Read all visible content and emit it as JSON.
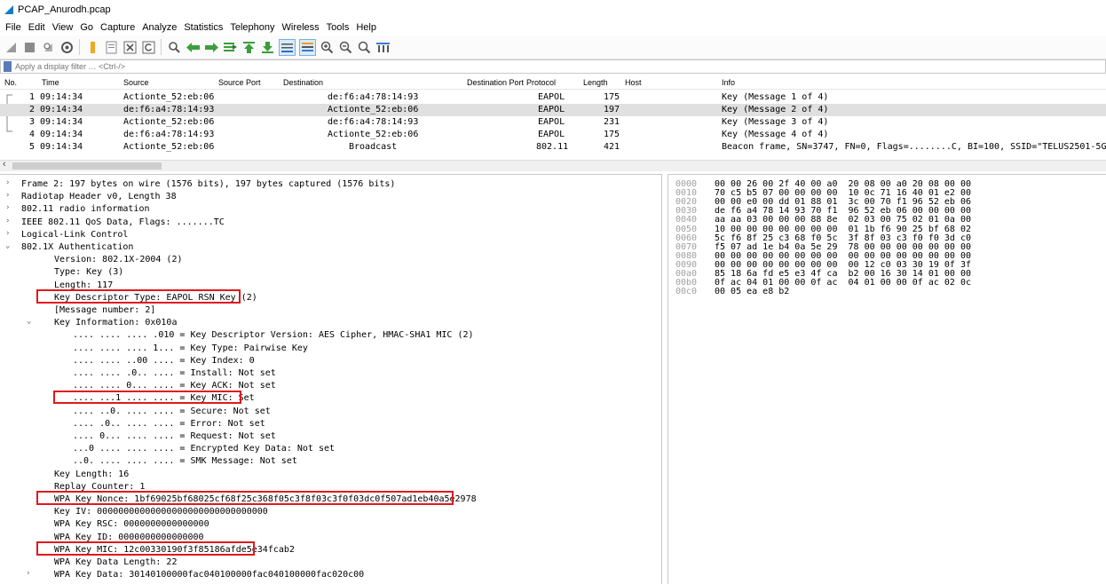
{
  "window": {
    "title": "PCAP_Anurodh.pcap"
  },
  "menu": [
    "File",
    "Edit",
    "View",
    "Go",
    "Capture",
    "Analyze",
    "Statistics",
    "Telephony",
    "Wireless",
    "Tools",
    "Help"
  ],
  "toolbar_icons": [
    "start-capture-icon",
    "stop-capture-icon",
    "restart-capture-icon",
    "capture-options-icon",
    "open-file-icon",
    "save-file-icon",
    "close-file-icon",
    "reload-file-icon",
    "find-packet-icon",
    "go-back-icon",
    "go-forward-icon",
    "go-to-packet-icon",
    "first-packet-icon",
    "last-packet-icon",
    "autoscroll-icon",
    "colorize-icon",
    "zoom-in-icon",
    "zoom-out-icon",
    "normal-size-icon",
    "resize-columns-icon"
  ],
  "filter": {
    "placeholder": "Apply a display filter … <Ctrl-/>"
  },
  "packet_list": {
    "headers": {
      "no": "No.",
      "time": "Time",
      "source": "Source",
      "source_port": "Source Port",
      "destination": "Destination",
      "destination_port": "Destination Port",
      "protocol": "Protocol",
      "length": "Length",
      "host": "Host",
      "info": "Info"
    },
    "rows": [
      {
        "no": "1",
        "time": "09:14:34",
        "source": "Actionte_52:eb:06",
        "destination": "de:f6:a4:78:14:93",
        "protocol": "EAPOL",
        "length": "175",
        "info": "Key (Message 1 of 4)"
      },
      {
        "no": "2",
        "time": "09:14:34",
        "source": "de:f6:a4:78:14:93",
        "destination": "Actionte_52:eb:06",
        "protocol": "EAPOL",
        "length": "197",
        "info": "Key (Message 2 of 4)"
      },
      {
        "no": "3",
        "time": "09:14:34",
        "source": "Actionte_52:eb:06",
        "destination": "de:f6:a4:78:14:93",
        "protocol": "EAPOL",
        "length": "231",
        "info": "Key (Message 3 of 4)"
      },
      {
        "no": "4",
        "time": "09:14:34",
        "source": "de:f6:a4:78:14:93",
        "destination": "Actionte_52:eb:06",
        "protocol": "EAPOL",
        "length": "175",
        "info": "Key (Message 4 of 4)"
      },
      {
        "no": "5",
        "time": "09:14:34",
        "source": "Actionte_52:eb:06",
        "destination": "Broadcast",
        "protocol": "802.11",
        "length": "421",
        "info": "Beacon frame, SN=3747, FN=0, Flags=........C, BI=100, SSID=\"TELUS2501-5G\""
      }
    ]
  },
  "details": [
    {
      "text": "Frame 2: 197 bytes on wire (1576 bits), 197 bytes captured (1576 bits)",
      "twisty": "›"
    },
    {
      "text": "Radiotap Header v0, Length 38",
      "twisty": "›"
    },
    {
      "text": "802.11 radio information",
      "twisty": "›"
    },
    {
      "text": "IEEE 802.11 QoS Data, Flags: .......TC",
      "twisty": "›"
    },
    {
      "text": "Logical-Link Control",
      "twisty": "›"
    },
    {
      "text": "802.1X Authentication",
      "twisty": "⌄"
    },
    {
      "text": "Version: 802.1X-2004 (2)",
      "twisty": ""
    },
    {
      "text": "Type: Key (3)",
      "twisty": ""
    },
    {
      "text": "Length: 117",
      "twisty": ""
    },
    {
      "text": "Key Descriptor Type: EAPOL RSN Key (2)",
      "twisty": ""
    },
    {
      "text": "[Message number: 2]",
      "twisty": ""
    },
    {
      "text": "Key Information: 0x010a",
      "twisty": "⌄"
    },
    {
      "text": ".... .... .... .010 = Key Descriptor Version: AES Cipher, HMAC-SHA1 MIC (2)",
      "twisty": ""
    },
    {
      "text": ".... .... .... 1... = Key Type: Pairwise Key",
      "twisty": ""
    },
    {
      "text": ".... .... ..00 .... = Key Index: 0",
      "twisty": ""
    },
    {
      "text": ".... .... .0.. .... = Install: Not set",
      "twisty": ""
    },
    {
      "text": ".... .... 0... .... = Key ACK: Not set",
      "twisty": ""
    },
    {
      "text": ".... ...1 .... .... = Key MIC: Set",
      "twisty": ""
    },
    {
      "text": ".... ..0. .... .... = Secure: Not set",
      "twisty": ""
    },
    {
      "text": ".... .0.. .... .... = Error: Not set",
      "twisty": ""
    },
    {
      "text": ".... 0... .... .... = Request: Not set",
      "twisty": ""
    },
    {
      "text": "...0 .... .... .... = Encrypted Key Data: Not set",
      "twisty": ""
    },
    {
      "text": "..0. .... .... .... = SMK Message: Not set",
      "twisty": ""
    },
    {
      "text": "Key Length: 16",
      "twisty": ""
    },
    {
      "text": "Replay Counter: 1",
      "twisty": ""
    },
    {
      "text": "WPA Key Nonce: 1bf69025bf68025cf68f25c368f05c3f8f03c3f0f03dc0f507ad1eb40a5e2978",
      "twisty": ""
    },
    {
      "text": "Key IV: 00000000000000000000000000000000",
      "twisty": ""
    },
    {
      "text": "WPA Key RSC: 0000000000000000",
      "twisty": ""
    },
    {
      "text": "WPA Key ID: 0000000000000000",
      "twisty": ""
    },
    {
      "text": "WPA Key MIC: 12c00330190f3f85186afde5e34fcab2",
      "twisty": ""
    },
    {
      "text": "WPA Key Data Length: 22",
      "twisty": ""
    },
    {
      "text": "WPA Key Data: 30140100000fac040100000fac040100000fac020c00",
      "twisty": "›"
    }
  ],
  "bytes": [
    {
      "offset": "0000",
      "hex": "00 00 26 00 2f 40 00 a0  20 08 00 a0 20 08 00 00"
    },
    {
      "offset": "0010",
      "hex": "70 c5 b5 07 00 00 00 00  10 0c 71 16 40 01 e2 00"
    },
    {
      "offset": "0020",
      "hex": "00 00 e0 00 dd 01 88 01  3c 00 70 f1 96 52 eb 06"
    },
    {
      "offset": "0030",
      "hex": "de f6 a4 78 14 93 70 f1  96 52 eb 06 00 00 00 00"
    },
    {
      "offset": "0040",
      "hex": "aa aa 03 00 00 00 88 8e  02 03 00 75 02 01 0a 00"
    },
    {
      "offset": "0050",
      "hex": "10 00 00 00 00 00 00 00  01 1b f6 90 25 bf 68 02"
    },
    {
      "offset": "0060",
      "hex": "5c f6 8f 25 c3 68 f0 5c  3f 8f 03 c3 f0 f0 3d c0"
    },
    {
      "offset": "0070",
      "hex": "f5 07 ad 1e b4 0a 5e 29  78 00 00 00 00 00 00 00"
    },
    {
      "offset": "0080",
      "hex": "00 00 00 00 00 00 00 00  00 00 00 00 00 00 00 00"
    },
    {
      "offset": "0090",
      "hex": "00 00 00 00 00 00 00 00  00 12 c0 03 30 19 0f 3f"
    },
    {
      "offset": "00a0",
      "hex": "85 18 6a fd e5 e3 4f ca  b2 00 16 30 14 01 00 00"
    },
    {
      "offset": "00b0",
      "hex": "0f ac 04 01 00 00 0f ac  04 01 00 00 0f ac 02 0c"
    },
    {
      "offset": "00c0",
      "hex": "00 05 ea e8 b2"
    }
  ],
  "colors": {
    "highlight_box": "#e0191e",
    "selected_row": "#e0e0e0",
    "offset_text": "#a0a0a0"
  }
}
